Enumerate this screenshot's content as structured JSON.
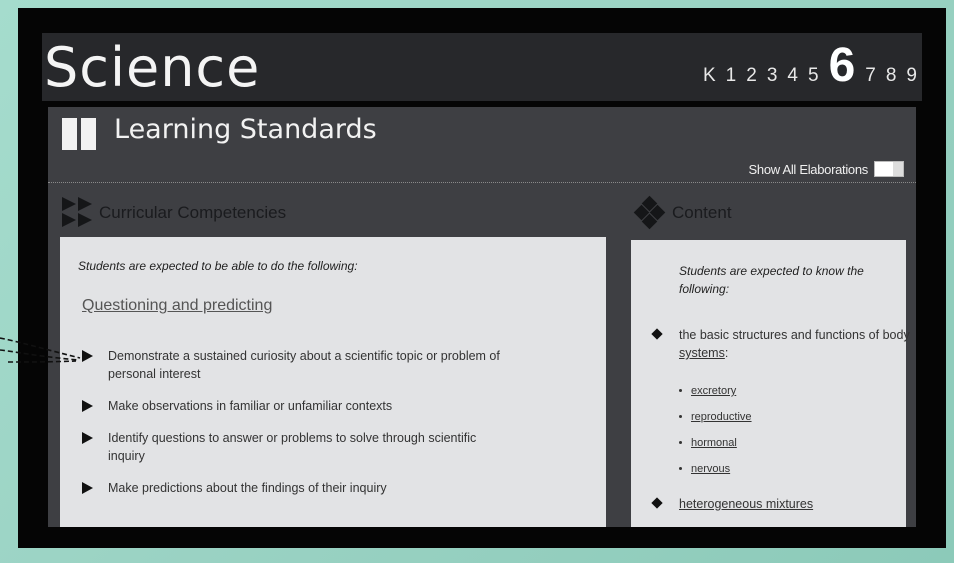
{
  "app_title": "Science",
  "grades": [
    {
      "label": "K",
      "active": false
    },
    {
      "label": "1",
      "active": false
    },
    {
      "label": "2",
      "active": false
    },
    {
      "label": "3",
      "active": false
    },
    {
      "label": "4",
      "active": false
    },
    {
      "label": "5",
      "active": false
    },
    {
      "label": "6",
      "active": true
    },
    {
      "label": "7",
      "active": false
    },
    {
      "label": "8",
      "active": false
    },
    {
      "label": "9",
      "active": false
    }
  ],
  "section_title": "Learning Standards",
  "show_all_label": "Show All Elaborations",
  "curricular": {
    "heading": "Curricular Competencies",
    "intro": "Students are expected to be able to do the following:",
    "subhead": "Questioning and predicting",
    "items": [
      {
        "line1": "Demonstrate a sustained curiosity about a scientific topic or problem of",
        "line2": "personal interest"
      },
      {
        "line1": "Make observations in familiar or unfamiliar contexts",
        "line2": ""
      },
      {
        "line1": "Identify questions to answer or problems to solve through scientific",
        "line2": "inquiry"
      },
      {
        "line1": "Make predictions about the findings of their inquiry",
        "line2": ""
      }
    ]
  },
  "content": {
    "heading": "Content",
    "intro": "Students are expected to know the following:",
    "item1_text": "the basic structures and functions of body",
    "item1_link": "systems",
    "item1_tail": ":",
    "sub_items": [
      "excretory",
      "reproductive",
      "hormonal",
      "nervous"
    ],
    "item2_link": "heterogeneous mixtures"
  }
}
